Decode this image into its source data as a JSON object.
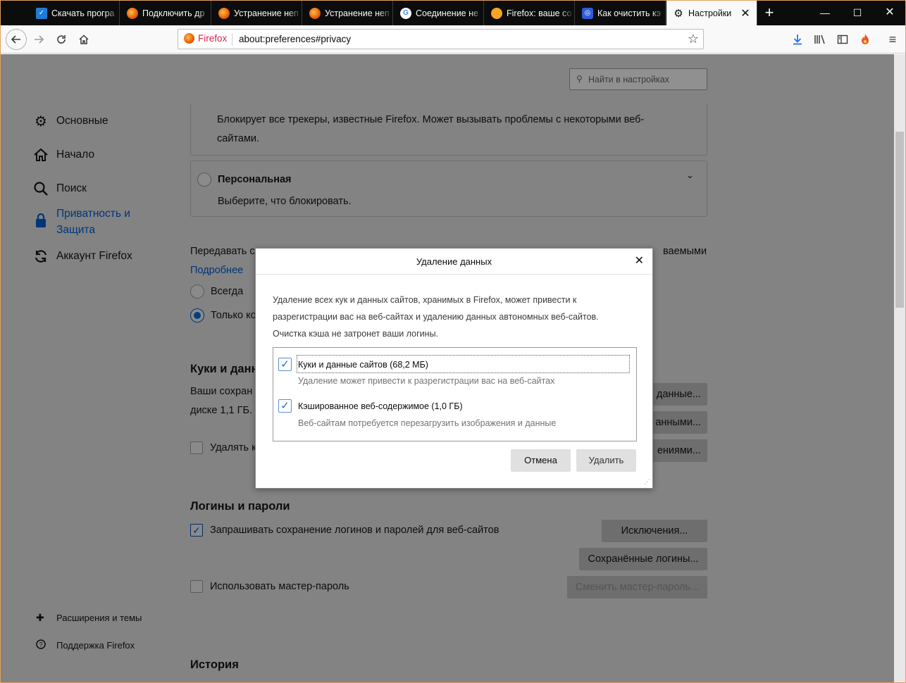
{
  "tabs": [
    {
      "label": "Скачать програ",
      "icon": "checkbox-app-icon",
      "color": "#1e7bd6"
    },
    {
      "label": "Подключить др",
      "icon": "firefox-icon",
      "color": "#e66000"
    },
    {
      "label": "Устранение неп",
      "icon": "firefox-icon",
      "color": "#e66000"
    },
    {
      "label": "Устранение неп",
      "icon": "firefox-icon",
      "color": "#e66000"
    },
    {
      "label": "Соединение не",
      "icon": "google-icon",
      "color": "#4285f4"
    },
    {
      "label": "Firefox: ваше со",
      "icon": "orange-dot-icon",
      "color": "#f5a623"
    },
    {
      "label": "Как очистить кэ",
      "icon": "site-icon",
      "color": "#2f5bd8"
    },
    {
      "label": "Настройки",
      "icon": "gear-icon",
      "color": "#0c0c0d"
    }
  ],
  "nav": {
    "brand": "Firefox",
    "url": "about:preferences#privacy"
  },
  "search": {
    "placeholder": "Найти в настройках"
  },
  "sidebar": {
    "items": [
      {
        "label": "Основные",
        "icon": "gear-icon"
      },
      {
        "label": "Начало",
        "icon": "home-icon"
      },
      {
        "label": "Поиск",
        "icon": "search-icon"
      },
      {
        "label1": "Приватность и",
        "label2": "Защита",
        "icon": "lock-icon"
      },
      {
        "label": "Аккаунт Firefox",
        "icon": "sync-icon"
      }
    ],
    "bottom": [
      {
        "label": "Расширения и темы",
        "icon": "puzzle-icon"
      },
      {
        "label": "Поддержка Firefox",
        "icon": "help-icon"
      }
    ]
  },
  "main": {
    "strict_desc1": "Блокирует все трекеры, известные Firefox. Может вызывать проблемы с некоторыми веб-",
    "strict_desc2": "сайтами.",
    "custom_title": "Персональная",
    "custom_desc": "Выберите, что блокировать.",
    "dnt_line_left": "Передавать с",
    "dnt_line_right": "ваемыми",
    "more_link": "Подробнее",
    "always": "Всегда",
    "only_when": "Только ко",
    "cookies_heading": "Куки и данн",
    "cookies_desc1": "Ваши сохран",
    "cookies_desc2": "диске 1,1 ГБ.",
    "delete_close": "Удалять к",
    "btn_clear": "данные...",
    "btn_manage": "анными...",
    "btn_exceptions_cookies": "ениями...",
    "logins_heading": "Логины и пароли",
    "logins_ask": "Запрашивать сохранение логинов и паролей для веб-сайтов",
    "btn_exceptions": "Исключения...",
    "btn_saved_logins": "Сохранённые логины...",
    "master_pw": "Использовать мастер-пароль",
    "btn_change_master": "Сменить мастер-пароль...",
    "history_heading": "История"
  },
  "dialog": {
    "title": "Удаление данных",
    "message1": "Удаление всех кук и данных сайтов, хранимых в Firefox, может привести к",
    "message2": "разрегистрации вас на веб-сайтах и удалению данных автономных веб-сайтов.",
    "message3": "Очистка кэша не затронет ваши логины.",
    "options": [
      {
        "label": "Куки и данные сайтов (68,2 МБ)",
        "desc": "Удаление может привести к разрегистрации вас на веб-сайтах",
        "checked": true
      },
      {
        "label": "Кэшированное веб-содержимое (1,0 ГБ)",
        "desc": "Веб-сайтам потребуется перезагрузить изображения и данные",
        "checked": true
      }
    ],
    "cancel": "Отмена",
    "delete": "Удалить"
  }
}
